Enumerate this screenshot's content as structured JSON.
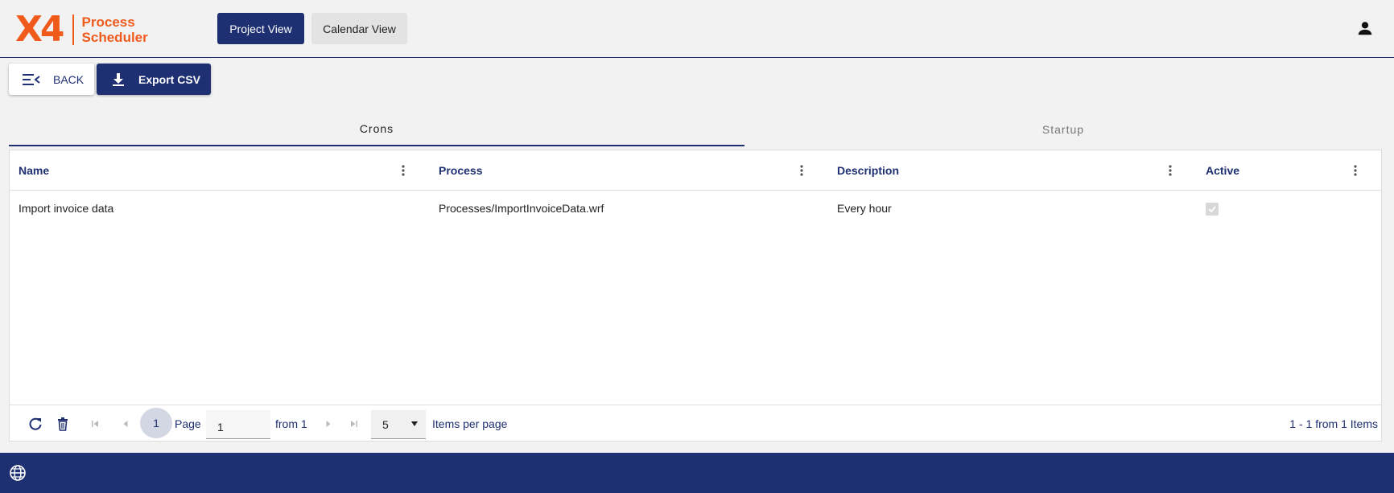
{
  "header": {
    "logo_mark": "X4",
    "logo_line1": "Process",
    "logo_line2": "Scheduler",
    "nav": {
      "project_view": "Project View",
      "calendar_view": "Calendar View"
    },
    "icons": {
      "user": "user-icon"
    }
  },
  "toolbar": {
    "back_label": "BACK",
    "export_label": "Export CSV"
  },
  "tabs": [
    {
      "label": "Crons",
      "active": true
    },
    {
      "label": "Startup",
      "active": false
    }
  ],
  "grid": {
    "columns": [
      "Name",
      "Process",
      "Description",
      "Active"
    ],
    "rows": [
      {
        "name": "Import invoice data",
        "process": "Processes/ImportInvoiceData.wrf",
        "description": "Every hour",
        "active": true
      }
    ]
  },
  "pager": {
    "current_page": "1",
    "page_label": "Page",
    "page_input_value": "1",
    "from_label": "from 1",
    "items_per_page_value": "5",
    "items_per_page_label": "Items per page",
    "summary": "1 - 1 from 1 Items"
  },
  "colors": {
    "primary": "#1e2f72",
    "brand": "#f05a1a"
  }
}
